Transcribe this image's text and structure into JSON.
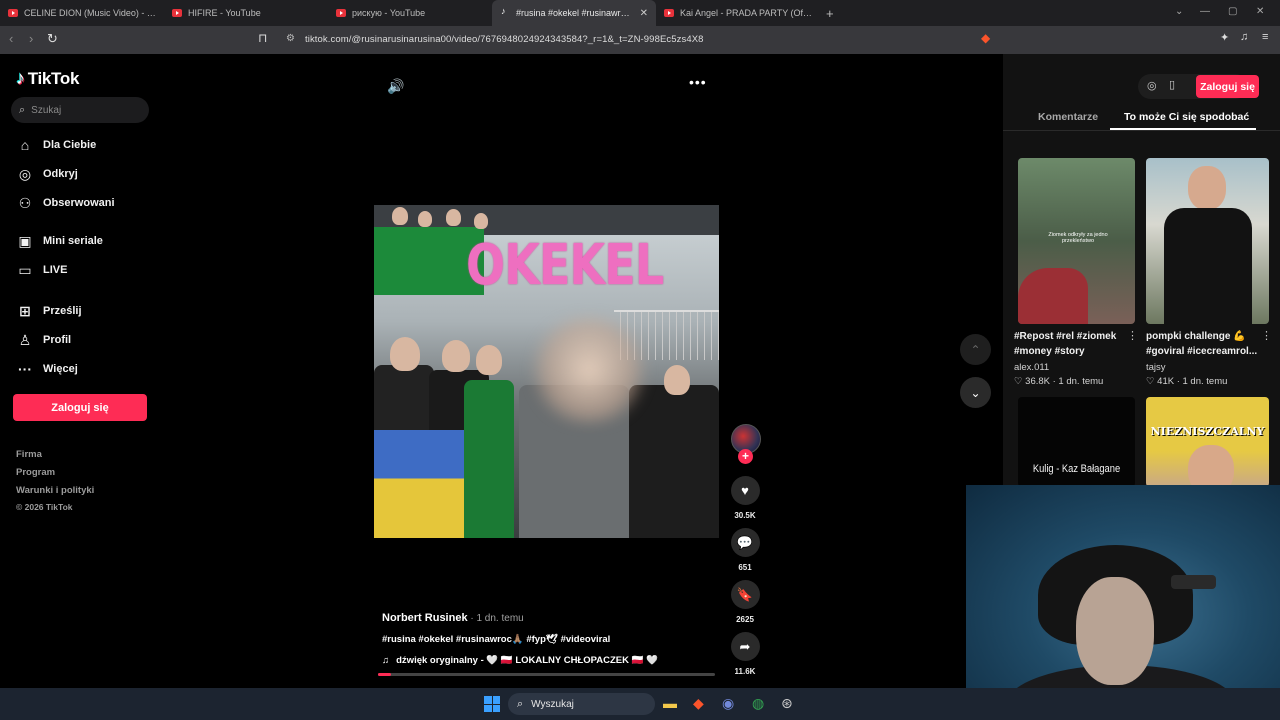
{
  "browser": {
    "tabs": [
      {
        "label": "CELINE DION (Music Video) - YouTube",
        "type": "yt",
        "active": false
      },
      {
        "label": "HIFIRE - YouTube",
        "type": "yt",
        "active": false
      },
      {
        "label": "рискую - YouTube",
        "type": "yt",
        "active": false
      },
      {
        "label": "#rusina #okekel #rusinawroc🙏🏽",
        "type": "tt",
        "active": true
      },
      {
        "label": "Kai Angel - PRADA PARTY (Official M",
        "type": "yt",
        "active": false
      }
    ],
    "new_tab": "+",
    "url": "tiktok.com/@rusinarusinarusina00/video/7676948024924343584?_r=1&_t=ZN-998Ec5zs4X8"
  },
  "sidebar": {
    "brand": "TikTok",
    "search_placeholder": "Szukaj",
    "items": [
      {
        "label": "Dla Ciebie",
        "icon": "home-icon"
      },
      {
        "label": "Odkryj",
        "icon": "compass-icon"
      },
      {
        "label": "Obserwowani",
        "icon": "following-icon"
      },
      {
        "label": "Mini seriale",
        "icon": "series-icon"
      },
      {
        "label": "LIVE",
        "icon": "live-icon"
      },
      {
        "label": "Prześlij",
        "icon": "upload-icon"
      },
      {
        "label": "Profil",
        "icon": "profile-icon"
      },
      {
        "label": "Więcej",
        "icon": "more-icon"
      }
    ],
    "login": "Zaloguj się",
    "footer": [
      "Firma",
      "Program",
      "Warunki i polityki",
      "© 2026 TikTok"
    ]
  },
  "video": {
    "overlay_text": "OKEKEL",
    "author": "Norbert Rusinek",
    "time": " · 1 dn. temu",
    "caption": "#rusina #okekel #rusinawroc🙏🏽 #fyp🕊 #videoviral",
    "sound": "dźwięk oryginalny - 🤍 🇵🇱 LOKALNY CHŁOPACZEK 🇵🇱 🤍",
    "progress": 0.04,
    "likes": "30.5K",
    "comments": "651",
    "saves": "2625",
    "shares": "11.6K"
  },
  "right_panel": {
    "login": "Zaloguj się",
    "tabs": [
      "Komentarze",
      "To może Ci się spodobać"
    ],
    "cards": [
      {
        "title": "#Repost #rel #ziomek #money #story",
        "author": "alex.011",
        "stats": "♡ 36.8K · 1 dn. temu",
        "thumb_text": "Ziomek odkryły za jedno przekleństwo"
      },
      {
        "title": "pompki challenge 💪 #goviral #icecreamrol...",
        "author": "tajsy",
        "stats": "♡ 41K · 1 dn. temu",
        "thumb_text": ""
      },
      {
        "title": "",
        "author": "",
        "stats": "",
        "thumb_text": "Kulig - Kaz Bałagane"
      },
      {
        "title": "",
        "author": "",
        "stats": "",
        "thumb_text": "NIEZNISZCZALNY"
      }
    ]
  },
  "taskbar": {
    "search": "Wyszukaj"
  },
  "colors": {
    "accent": "#fe2c55",
    "background": "#000000",
    "panel": "#121212"
  }
}
